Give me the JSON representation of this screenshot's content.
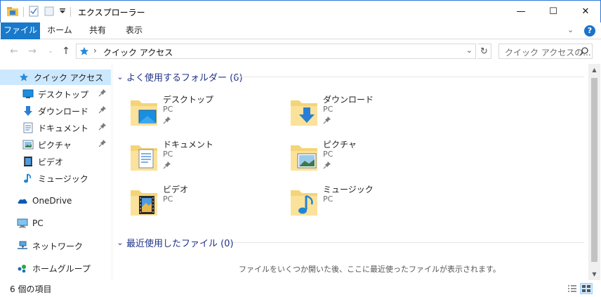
{
  "window": {
    "title": "エクスプローラー",
    "minimize_glyph": "—",
    "maximize_glyph": "☐",
    "close_glyph": "✕"
  },
  "ribbon": {
    "tabs": [
      {
        "label": "ファイル",
        "active": true
      },
      {
        "label": "ホーム"
      },
      {
        "label": "共有"
      },
      {
        "label": "表示"
      }
    ],
    "expand_glyph": "⌄",
    "help_glyph": "?"
  },
  "navigation": {
    "address_path": "クイック アクセス",
    "search_placeholder": "クイック アクセスの...",
    "back_glyph": "←",
    "forward_glyph": "→",
    "recent_glyph": "⌄",
    "up_glyph": "↑",
    "refresh_glyph": "↻"
  },
  "sidebar": {
    "items": [
      {
        "label": "クイック アクセス",
        "icon": "star-icon",
        "selected": true
      },
      {
        "label": "デスクトップ",
        "icon": "desktop-icon",
        "pinned": true
      },
      {
        "label": "ダウンロード",
        "icon": "download-icon",
        "pinned": true
      },
      {
        "label": "ドキュメント",
        "icon": "document-icon",
        "pinned": true
      },
      {
        "label": "ピクチャ",
        "icon": "picture-icon",
        "pinned": true
      },
      {
        "label": "ビデオ",
        "icon": "video-icon"
      },
      {
        "label": "ミュージック",
        "icon": "music-icon"
      },
      {
        "label": "OneDrive",
        "icon": "onedrive-icon"
      },
      {
        "label": "PC",
        "icon": "pc-icon"
      },
      {
        "label": "ネットワーク",
        "icon": "network-icon"
      },
      {
        "label": "ホームグループ",
        "icon": "homegroup-icon"
      }
    ]
  },
  "content": {
    "frequent_header": "よく使用するフォルダー (6)",
    "recent_header": "最近使用したファイル (0)",
    "recent_empty_message": "ファイルをいくつか開いた後、ここに最近使ったファイルが表示されます。",
    "folders": [
      {
        "name": "デスクトップ",
        "location": "PC",
        "overlay": "desktop-icon",
        "pinned": true
      },
      {
        "name": "ダウンロード",
        "location": "PC",
        "overlay": "download-icon",
        "pinned": true
      },
      {
        "name": "ドキュメント",
        "location": "PC",
        "overlay": "document-icon",
        "pinned": true
      },
      {
        "name": "ピクチャ",
        "location": "PC",
        "overlay": "picture-icon",
        "pinned": true
      },
      {
        "name": "ビデオ",
        "location": "PC",
        "overlay": "video-icon"
      },
      {
        "name": "ミュージック",
        "location": "PC",
        "overlay": "music-icon"
      }
    ]
  },
  "statusbar": {
    "item_count": "6 個の項目"
  },
  "colors": {
    "accent": "#1979ca",
    "selection": "#cce8ff",
    "group_header": "#1e3287",
    "folder": "#f8d775"
  }
}
